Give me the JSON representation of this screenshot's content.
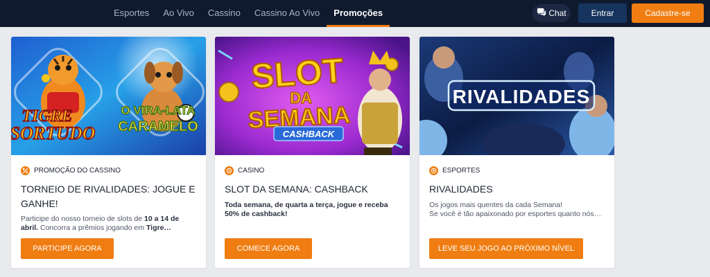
{
  "nav": {
    "links": [
      {
        "label": "Esportes"
      },
      {
        "label": "Ao Vivo"
      },
      {
        "label": "Cassino"
      },
      {
        "label": "Cassino Ao Vivo"
      },
      {
        "label": "Promoções"
      }
    ],
    "active_index": 4,
    "chat_label": "Chat",
    "login_label": "Entrar",
    "signup_label": "Cadastre-se"
  },
  "colors": {
    "accent": "#f07d12",
    "nav_background": "#0f1a2e",
    "login_background": "#16345e",
    "page_background": "#e9eaee"
  },
  "cards": [
    {
      "image_text": {
        "line1": "TIGRE",
        "line2": "SORTUDO",
        "line3": "O VIRA-LATA",
        "line4": "CARAMELO"
      },
      "category": "PROMOÇÃO DO CASSINO",
      "title": "TORNEIO DE RIVALIDADES: JOGUE E GANHE!",
      "desc": {
        "p1": "Participe do nosso torneio de slots de ",
        "b1": "10 a 14 de abril.",
        "p2": " Concorra a prêmios jogando em ",
        "b2": "Tigre…"
      },
      "button": "PARTICIPE AGORA"
    },
    {
      "image_text": {
        "line1": "SLOT",
        "line2": "DA",
        "line3": "SEMANA",
        "line4": "CASHBACK"
      },
      "category": "CASINO",
      "title": "SLOT DA SEMANA: CASHBACK",
      "desc": {
        "b1": "Toda semana, de quarta a terça, jogue e receba 50% de cashback!"
      },
      "button": "COMECE AGORA"
    },
    {
      "image_text": {
        "line1": "RIVALIDADES"
      },
      "category": "ESPORTES",
      "title": "RIVALIDADES",
      "desc": {
        "line1": "Os jogos mais quentes da cada Semana!",
        "line2": "Se você é tão apaixonado por esportes quanto nós…"
      },
      "button": "LEVE SEU JOGO AO PRÓXIMO NÍVEL"
    }
  ]
}
